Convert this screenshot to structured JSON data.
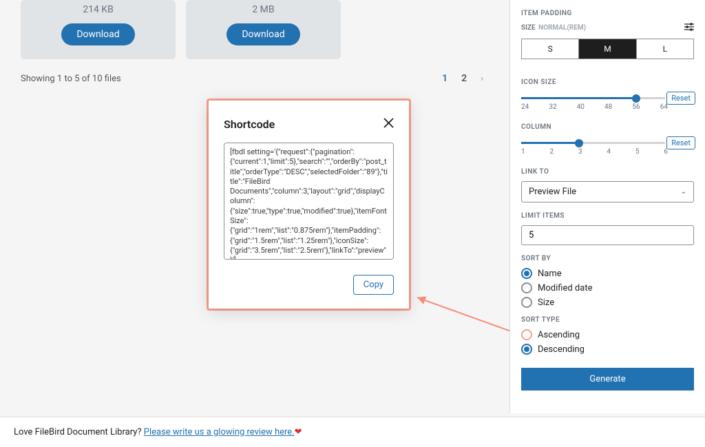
{
  "cards": [
    {
      "size": "214 KB",
      "btn": "Download"
    },
    {
      "size": "2 MB",
      "btn": "Download"
    }
  ],
  "pagination": {
    "summary": "Showing 1 to 5 of 10 files",
    "pages": [
      "1",
      "2"
    ]
  },
  "modal": {
    "title": "Shortcode",
    "content": "[fbdl setting='{\"request\":{\"pagination\":{\"current\":1,\"limit\":5},\"search\":\"\",\"orderBy\":\"post_title\",\"orderType\":\"DESC\",\"selectedFolder\":\"89\"},\"title\":\"FileBird Documents\",\"column\":3,\"layout\":\"grid\",\"displayColumn\":{\"size\":true,\"type\":true,\"modified\":true},\"itemFontSize\":{\"grid\":\"1rem\",\"list\":\"0.875rem\"},\"itemPadding\":{\"grid\":\"1.5rem\",\"list\":\"1.25rem\"},\"iconSize\":{\"grid\":\"3.5rem\",\"list\":\"2.5rem\"},\"linkTo\":\"preview\"}']",
    "copy": "Copy"
  },
  "sidebar": {
    "itemPadding": {
      "label": "ITEM PADDING",
      "sizeLabel": "SIZE",
      "sizeVal": "NORMAL(REM)",
      "opts": [
        "S",
        "M",
        "L"
      ]
    },
    "iconSize": {
      "label": "ICON SIZE",
      "ticks": [
        "24",
        "32",
        "40",
        "48",
        "56",
        "64"
      ],
      "reset": "Reset"
    },
    "column": {
      "label": "COLUMN",
      "ticks": [
        "1",
        "2",
        "3",
        "4",
        "5",
        "6"
      ],
      "reset": "Reset"
    },
    "linkTo": {
      "label": "LINK TO",
      "value": "Preview File"
    },
    "limitItems": {
      "label": "LIMIT ITEMS",
      "value": "5"
    },
    "sortBy": {
      "label": "SORT BY",
      "opts": [
        "Name",
        "Modified date",
        "Size"
      ]
    },
    "sortType": {
      "label": "SORT TYPE",
      "opts": [
        "Ascending",
        "Descending"
      ]
    },
    "generate": "Generate"
  },
  "footer": {
    "text": "Love FileBird Document Library? ",
    "link": "Please write us a glowing review here."
  }
}
